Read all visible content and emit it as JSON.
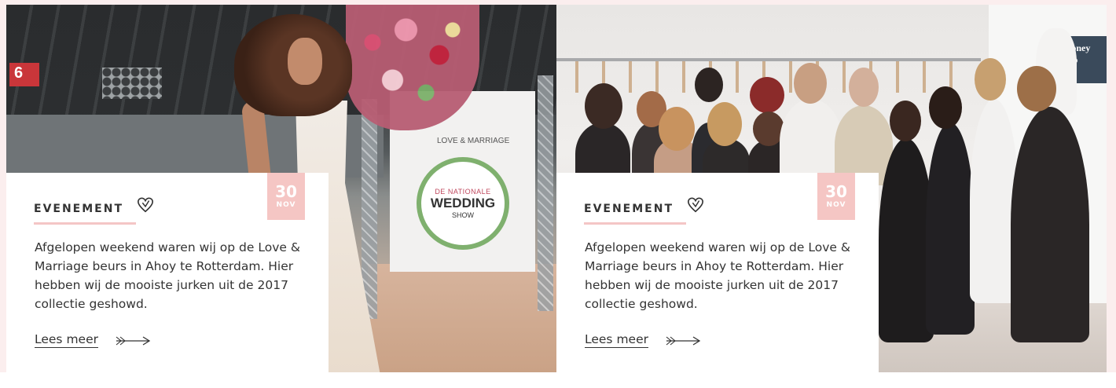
{
  "cards": [
    {
      "category": "EVENEMENT",
      "date_day": "30",
      "date_month": "NOV",
      "excerpt": "Afgelopen weekend waren wij op de Love & Marriage beurs in Ahoy te Rotterdam. Hier hebben wij de mooiste jurken uit de 2017 collectie geshowd.",
      "link_label": "Lees meer",
      "photo": {
        "hall_number": "6",
        "backdrop_line1": "DE NATIONALE",
        "backdrop_line2": "WEDDING",
        "backdrop_line3": "SHOW",
        "backdrop_top": "LOVE & MARRIAGE"
      }
    },
    {
      "category": "EVENEMENT",
      "date_day": "30",
      "date_month": "NOV",
      "excerpt": "Afgelopen weekend waren wij op de Love & Marriage beurs in Ahoy te Rotterdam. Hier hebben wij de mooiste jurken uit de 2017 collectie geshowd.",
      "link_label": "Lees meer",
      "photo": {
        "store_sign": "Honey sho"
      }
    }
  ],
  "colors": {
    "accent_pink": "#f5c6c4",
    "text": "#333333",
    "page_bg": "#fbeeee"
  },
  "icons": [
    "heart-icon",
    "arrow-right-icon"
  ]
}
